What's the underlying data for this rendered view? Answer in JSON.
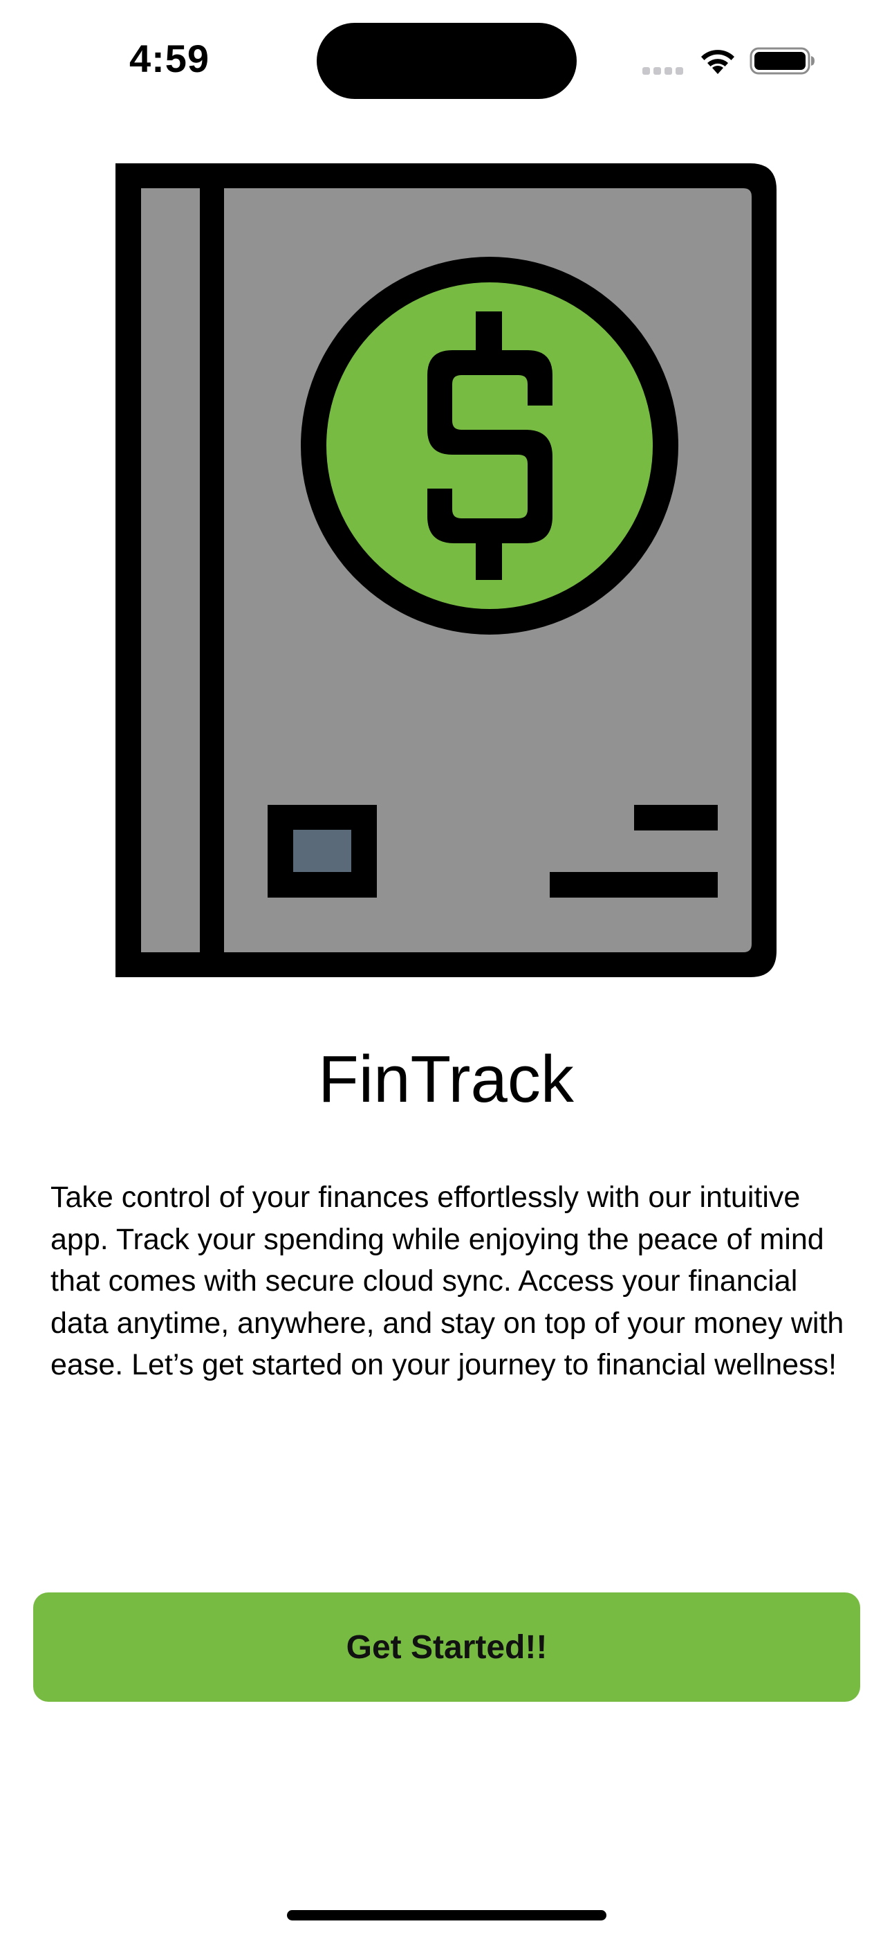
{
  "status_bar": {
    "time": "4:59",
    "icons": [
      "cellular-signal-icon",
      "wifi-icon",
      "battery-icon"
    ]
  },
  "logo": {
    "icon": "ledger-book-dollar-icon",
    "colors": {
      "cover": "#929292",
      "coin": "#78bb43",
      "outline": "#000000",
      "label": "#5a6a78"
    }
  },
  "onboarding": {
    "title": "FinTrack",
    "description": "Take control of your finances effortlessly with our intuitive app. Track your spending while enjoying the peace of mind that comes with secure cloud sync. Access your financial data anytime, anywhere, and stay on top of your money with ease. Let’s get started on your journey to financial wellness!",
    "cta_label": "Get Started!!",
    "accent_color": "#78bb43"
  }
}
